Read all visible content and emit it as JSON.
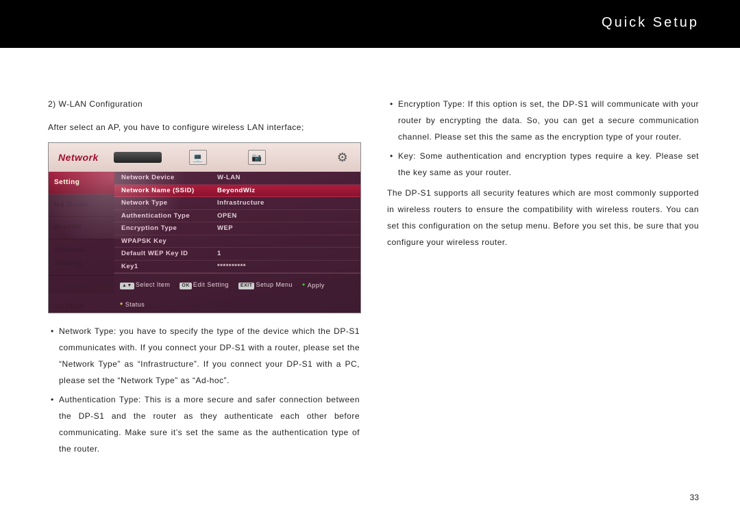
{
  "header": {
    "title": "Quick Setup"
  },
  "page_number": "33",
  "left": {
    "heading": "2) W-LAN Configuration",
    "intro": "After select an AP, you have to configure wireless LAN interface;",
    "bullets": [
      "Network Type: you have to specify the type of the device which the DP-S1 communicates with. If you connect your DP-S1 with a router, please set the “Network Type” as “Infrastructure”. If you connect your DP-S1 with a PC, please set the “Network Type” as “Ad-hoc”.",
      "Authentication Type: This is a more secure and safer connection between the DP-S1 and the router as they authenticate each other before communicating. Make sure it’s set the same as the authentication type of the router."
    ]
  },
  "right": {
    "bullets": [
      "Encryption Type: If this option is set, the DP-S1 will communicate with your router by encrypting the data. So, you can get a secure communication channel. Please set this the same as the encryption type of your router.",
      "Key: Some authentication and encryption types require a key. Please set the key same as your router."
    ],
    "para": "The DP-S1 supports all security features which are most commonly supported in wireless routers to ensure the compatibility with wireless routers. You can set this configuration on the setup menu. Before you set this, be sure that you configure your wireless router."
  },
  "screenshot": {
    "brand": "Network",
    "sidebar": {
      "items": [
        "Setting",
        "Ice Guide",
        "WizPNP",
        "Windows Sharing"
      ],
      "active_index": 0,
      "time": "12:18am"
    },
    "rows": [
      {
        "label": "Network Device",
        "value": "W-LAN",
        "hl": false
      },
      {
        "label": "Network Name (SSID)",
        "value": "BeyondWiz",
        "hl": true
      },
      {
        "label": "Network Type",
        "value": "Infrastructure",
        "hl": false
      },
      {
        "label": "Authentication Type",
        "value": "OPEN",
        "hl": false
      },
      {
        "label": "Encryption Type",
        "value": "WEP",
        "hl": false
      },
      {
        "label": "WPAPSK Key",
        "value": "",
        "hl": false
      },
      {
        "label": "Default WEP Key ID",
        "value": "1",
        "hl": false
      },
      {
        "label": "Key1",
        "value": "**********",
        "hl": false
      }
    ],
    "footer": {
      "select_badge": "▲▼",
      "select": "Select Item",
      "edit_badge": "OK",
      "edit": "Edit Setting",
      "menu_badge": "EXIT",
      "menu": "Setup Menu",
      "apply": "Apply",
      "status": "Status"
    }
  }
}
